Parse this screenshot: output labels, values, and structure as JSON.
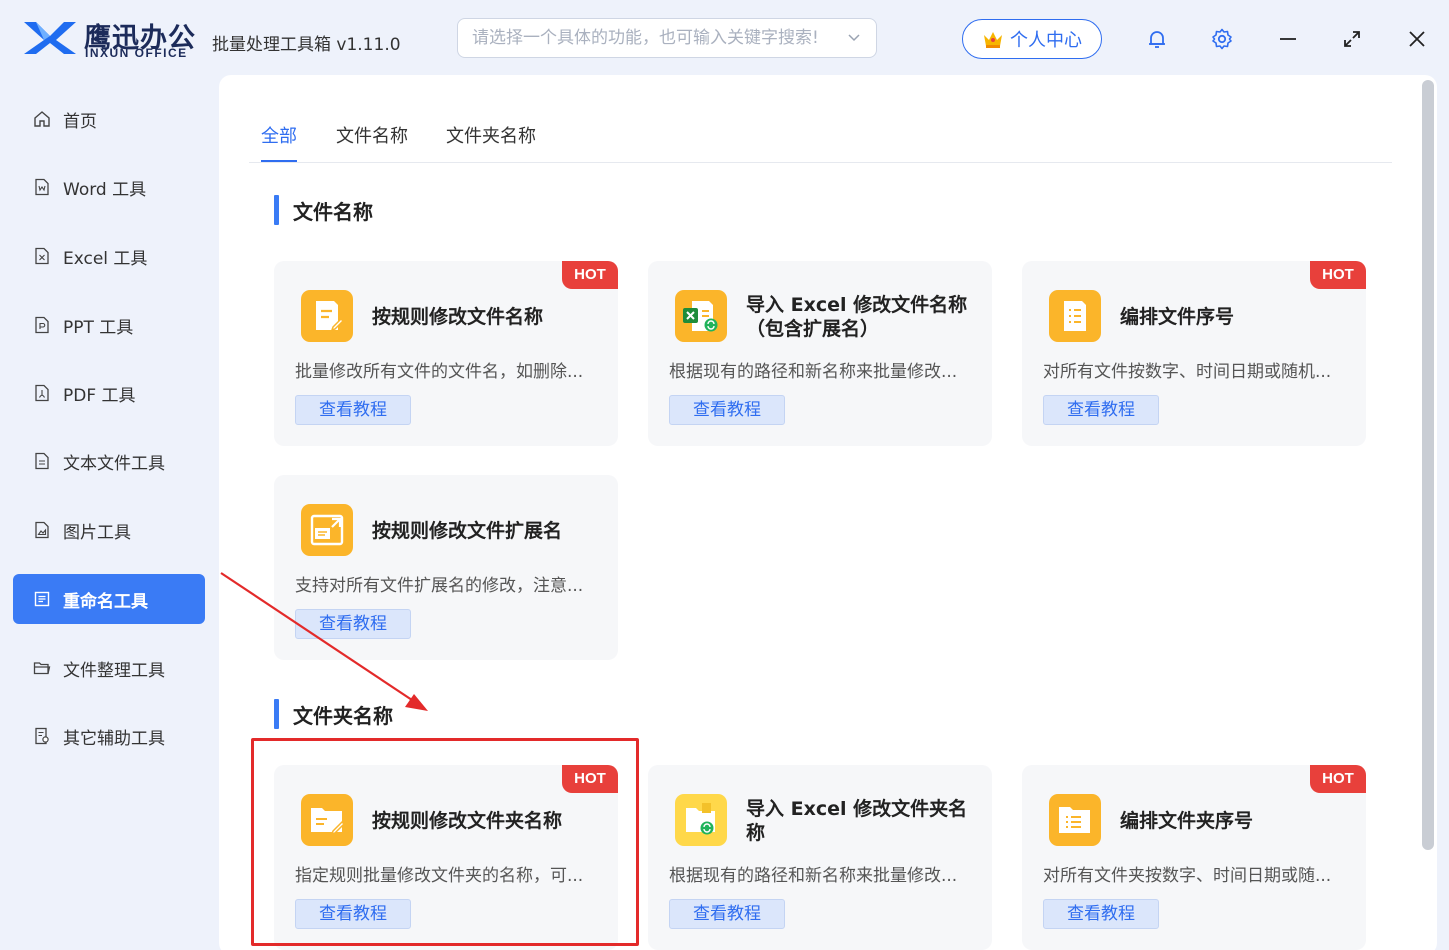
{
  "app": {
    "logo_cn": "鹰迅办公",
    "logo_en": "INXUN OFFICE",
    "title": "批量处理工具箱 v1.11.0"
  },
  "search": {
    "placeholder": "请选择一个具体的功能，也可输入关键字搜索!"
  },
  "header": {
    "user_center": "个人中心"
  },
  "sidebar": {
    "items": [
      {
        "label": "首页",
        "icon": "home-icon"
      },
      {
        "label": "Word 工具",
        "icon": "word-file-icon"
      },
      {
        "label": "Excel 工具",
        "icon": "excel-file-icon"
      },
      {
        "label": "PPT 工具",
        "icon": "ppt-file-icon"
      },
      {
        "label": "PDF 工具",
        "icon": "pdf-file-icon"
      },
      {
        "label": "文本文件工具",
        "icon": "text-file-icon"
      },
      {
        "label": "图片工具",
        "icon": "image-file-icon"
      },
      {
        "label": "重命名工具",
        "icon": "rename-icon",
        "active": true
      },
      {
        "label": "文件整理工具",
        "icon": "folder-icon"
      },
      {
        "label": "其它辅助工具",
        "icon": "tools-icon"
      }
    ]
  },
  "tabs": [
    {
      "label": "全部",
      "active": true
    },
    {
      "label": "文件名称"
    },
    {
      "label": "文件夹名称"
    }
  ],
  "sections": [
    {
      "title": "文件名称",
      "cards": [
        {
          "title": "按规则修改文件名称",
          "desc": "批量修改所有文件的文件名，如删除...",
          "button": "查看教程",
          "badge": "HOT"
        },
        {
          "title": "导入 Excel 修改文件名称（包含扩展名）",
          "desc": "根据现有的路径和新名称来批量修改...",
          "button": "查看教程"
        },
        {
          "title": "编排文件序号",
          "desc": "对所有文件按数字、时间日期或随机...",
          "button": "查看教程",
          "badge": "HOT"
        },
        {
          "title": "按规则修改文件扩展名",
          "desc": "支持对所有文件扩展名的修改，注意...",
          "button": "查看教程"
        }
      ]
    },
    {
      "title": "文件夹名称",
      "cards": [
        {
          "title": "按规则修改文件夹名称",
          "desc": "指定规则批量修改文件夹的名称，可...",
          "button": "查看教程",
          "badge": "HOT"
        },
        {
          "title": "导入 Excel 修改文件夹名称",
          "desc": "根据现有的路径和新名称来批量修改...",
          "button": "查看教程"
        },
        {
          "title": "编排文件夹序号",
          "desc": "对所有文件夹按数字、时间日期或随...",
          "button": "查看教程",
          "badge": "HOT"
        }
      ]
    }
  ],
  "colors": {
    "accent": "#3a7bf5",
    "hot_badge": "#e8403b",
    "icon_orange": "#fbb52a",
    "annotation_red": "#e32a2a"
  }
}
